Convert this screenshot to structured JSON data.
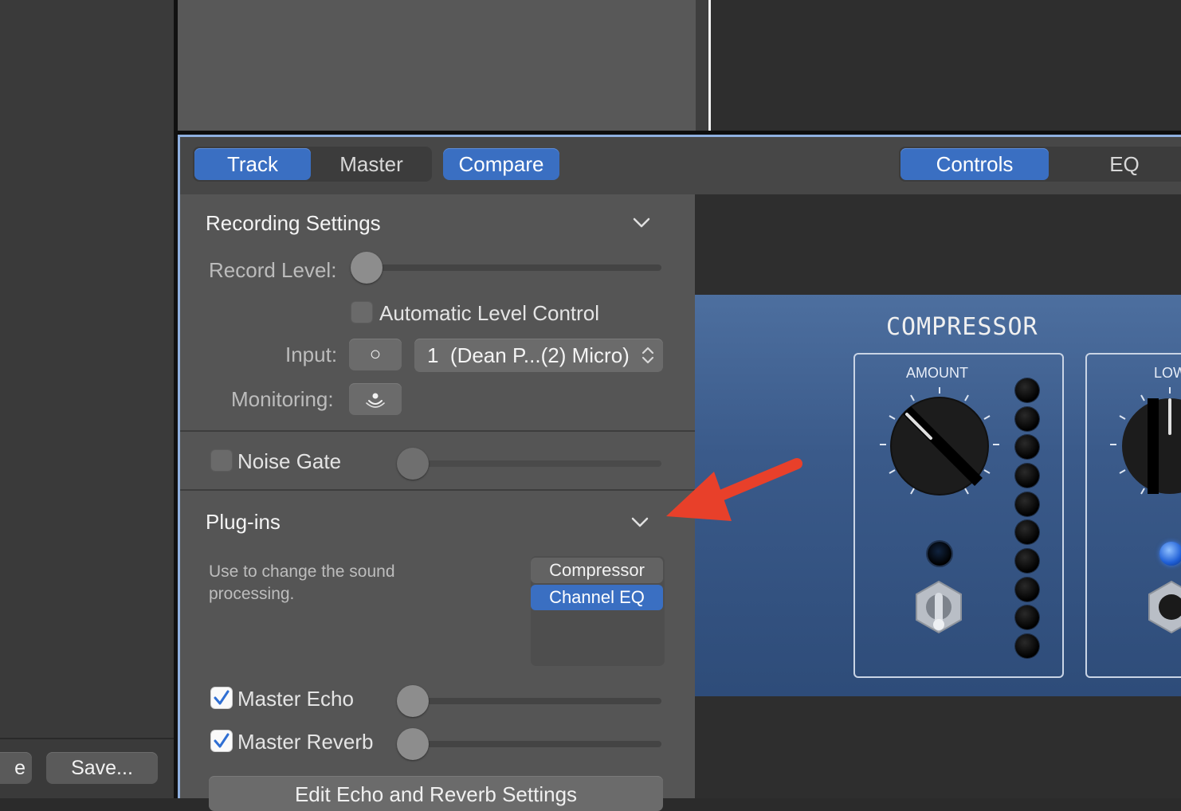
{
  "left_sidebar": {
    "partial_button_label": "e",
    "save_button_label": "Save..."
  },
  "toolbar": {
    "mode_tabs": [
      {
        "label": "Track",
        "active": true
      },
      {
        "label": "Master",
        "active": false
      }
    ],
    "compare_label": "Compare",
    "view_tabs": [
      {
        "label": "Controls",
        "active": true
      },
      {
        "label": "EQ",
        "active": false
      }
    ]
  },
  "recording_settings": {
    "title": "Recording Settings",
    "record_level_label": "Record Level:",
    "record_level_value": 0,
    "auto_level_label": "Automatic Level Control",
    "auto_level_checked": false,
    "input_label": "Input:",
    "input_format_glyph": "○",
    "input_source": "1  (Dean P...(2) Micro)",
    "monitoring_label": "Monitoring:"
  },
  "noise_gate": {
    "label": "Noise Gate",
    "checked": false,
    "value": 0
  },
  "plugins": {
    "title": "Plug-ins",
    "description": "Use to change the sound processing.",
    "items": [
      {
        "label": "Compressor",
        "selected": false
      },
      {
        "label": "Channel EQ",
        "selected": true
      }
    ]
  },
  "master_effects": {
    "echo": {
      "label": "Master Echo",
      "checked": true,
      "value": 0
    },
    "reverb": {
      "label": "Master Reverb",
      "checked": true,
      "value": 0
    },
    "edit_button_label": "Edit Echo and Reverb Settings"
  },
  "compressor": {
    "title": "COMPRESSOR",
    "amount_label": "AMOUNT",
    "second_label": "LOW"
  },
  "colors": {
    "accent": "#3a6fc2",
    "annotation_arrow": "#e8402a",
    "plugin_panel": "#3a5a8a"
  }
}
